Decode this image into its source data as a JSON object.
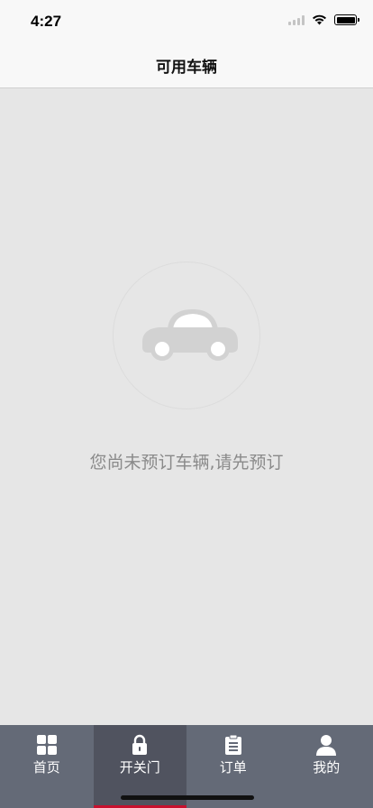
{
  "status_bar": {
    "time": "4:27"
  },
  "nav": {
    "title": "可用车辆"
  },
  "empty_state": {
    "message": "您尚未预订车辆,请先预订",
    "icon": "car-icon"
  },
  "tabs": [
    {
      "label": "首页",
      "icon": "grid-icon",
      "active": false
    },
    {
      "label": "开关门",
      "icon": "lock-icon",
      "active": true
    },
    {
      "label": "订单",
      "icon": "clipboard-icon",
      "active": false
    },
    {
      "label": "我的",
      "icon": "person-icon",
      "active": false
    }
  ],
  "colors": {
    "background": "#e6e6e6",
    "tab_bar": "#646a77",
    "tab_active": "#50535f",
    "accent": "#c8102e"
  }
}
